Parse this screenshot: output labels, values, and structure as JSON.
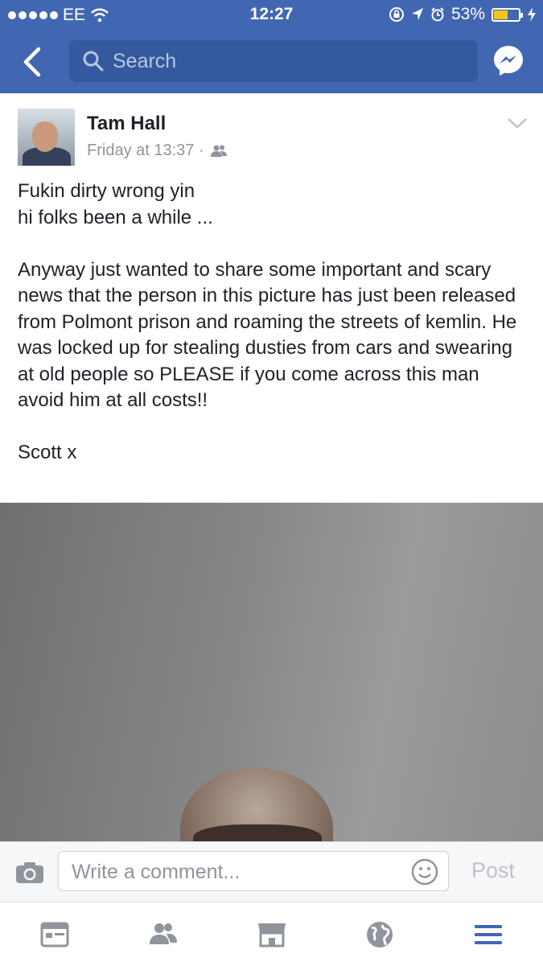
{
  "status_bar": {
    "carrier": "EE",
    "time": "12:27",
    "battery": "53%"
  },
  "nav": {
    "search_placeholder": "Search"
  },
  "post": {
    "author": "Tam Hall",
    "time": "Friday at 13:37 ·",
    "privacy_icon": "friends-icon",
    "text": "Fukin dirty wrong yin\nhi folks been a while ...\n\nAnyway just wanted to share some important and scary news that the person in this picture has just been released from Polmont prison and roaming the streets of kemlin. He was locked up for stealing dusties from cars and swearing at old people so PLEASE if you come across this man avoid him at all costs!!\n\nScott x"
  },
  "composer": {
    "placeholder": "Write a comment...",
    "post_label": "Post"
  },
  "tabs": [
    "news-feed-icon",
    "friends-icon",
    "marketplace-icon",
    "globe-notifications-icon",
    "menu-icon"
  ],
  "colors": {
    "brand": "#4267b2",
    "active_tab": "#4267b2",
    "inactive": "#90949c"
  }
}
